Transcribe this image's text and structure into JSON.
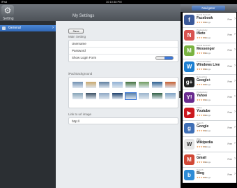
{
  "statusbar": {
    "carrier": "iPad",
    "time": "10:10:38 PM"
  },
  "header": {
    "setting_label": "Setting",
    "title": "My Settings",
    "gear_symbol": "⚙"
  },
  "sidebar": {
    "items": [
      {
        "label": "General"
      }
    ]
  },
  "settings": {
    "save_label": "Save",
    "main_section": "Main Setting",
    "username_label": "Username",
    "username_value": "",
    "password_label": "Password",
    "password_value": "",
    "show_login_label": "Show Login Form",
    "show_login_on": true,
    "background_section": "iPad Background",
    "link_section": "Link to url image",
    "link_value": "http://"
  },
  "backgrounds": [
    {
      "color": "#6f8fb1",
      "selected": false
    },
    {
      "color": "#c9a86b",
      "selected": false
    },
    {
      "color": "#5d7e9f",
      "selected": false
    },
    {
      "color": "#8fb0d4",
      "selected": false
    },
    {
      "color": "#3f6f3a",
      "selected": false
    },
    {
      "color": "#6e9b5e",
      "selected": false
    },
    {
      "color": "#2a5d8f",
      "selected": false
    },
    {
      "color": "#c55d2f",
      "selected": false
    },
    {
      "color": "#86a4b8",
      "selected": false
    },
    {
      "color": "#3b4f63",
      "selected": false
    },
    {
      "color": "#8da7c4",
      "selected": false
    },
    {
      "color": "#1c3f6b",
      "selected": false
    },
    {
      "color": "#587fa8",
      "selected": true
    },
    {
      "color": "#9ab4cc",
      "selected": false
    },
    {
      "color": "#2e5e44",
      "selected": false
    },
    {
      "color": "#7da0c2",
      "selected": false
    }
  ],
  "right": {
    "title": "Navigator"
  },
  "apps": [
    {
      "category": "Social Network",
      "name": "Facebook",
      "ratings": "Ratings",
      "price": "Free",
      "icon_bg": "#3b5998",
      "icon_glyph": "f",
      "stars": "★★★★★"
    },
    {
      "category": "Productivity",
      "name": "iNote",
      "ratings": "Ratings",
      "price": "Free",
      "icon_bg": "#d9534f",
      "icon_glyph": "N",
      "stars": "★★★★★"
    },
    {
      "category": "Social Network",
      "name": "Messenger",
      "ratings": "Ratings",
      "price": "Free",
      "icon_bg": "#7ab341",
      "icon_glyph": "M",
      "stars": "★★★★★"
    },
    {
      "category": "Communication",
      "name": "Windows Live",
      "ratings": "Ratings",
      "price": "Free",
      "icon_bg": "#1d7fd1",
      "icon_glyph": "W",
      "stars": "★★★★★"
    },
    {
      "category": "Networking",
      "name": "Google+",
      "ratings": "Ratings",
      "price": "Free",
      "icon_bg": "#222222",
      "icon_glyph": "g+",
      "stars": "★★★★★"
    },
    {
      "category": "Productivity",
      "name": "Yahoo",
      "ratings": "Ratings",
      "price": "Free",
      "icon_bg": "#6a2a8e",
      "icon_glyph": "Y!",
      "stars": "★★★★★"
    },
    {
      "category": "Video",
      "name": "Youtube",
      "ratings": "Ratings",
      "price": "Free",
      "icon_bg": "#cc181e",
      "icon_glyph": "▶",
      "stars": "★★★★★"
    },
    {
      "category": "Search",
      "name": "Google",
      "ratings": "Ratings",
      "price": "Free",
      "icon_bg": "#3f6fb6",
      "icon_glyph": "g",
      "stars": "★★★★★"
    },
    {
      "category": "Wiki",
      "name": "Wikipedia",
      "ratings": "Ratings",
      "price": "Free",
      "icon_bg": "#e5e5e5",
      "icon_glyph": "W",
      "stars": "★★★★★"
    },
    {
      "category": "Mail",
      "name": "Gmail",
      "ratings": "Ratings",
      "price": "Free",
      "icon_bg": "#d14836",
      "icon_glyph": "M",
      "stars": "★★★★★"
    },
    {
      "category": "Search",
      "name": "Bing",
      "ratings": "Ratings",
      "price": "Free",
      "icon_bg": "#2e8bd6",
      "icon_glyph": "b",
      "stars": "★★★★★"
    }
  ]
}
